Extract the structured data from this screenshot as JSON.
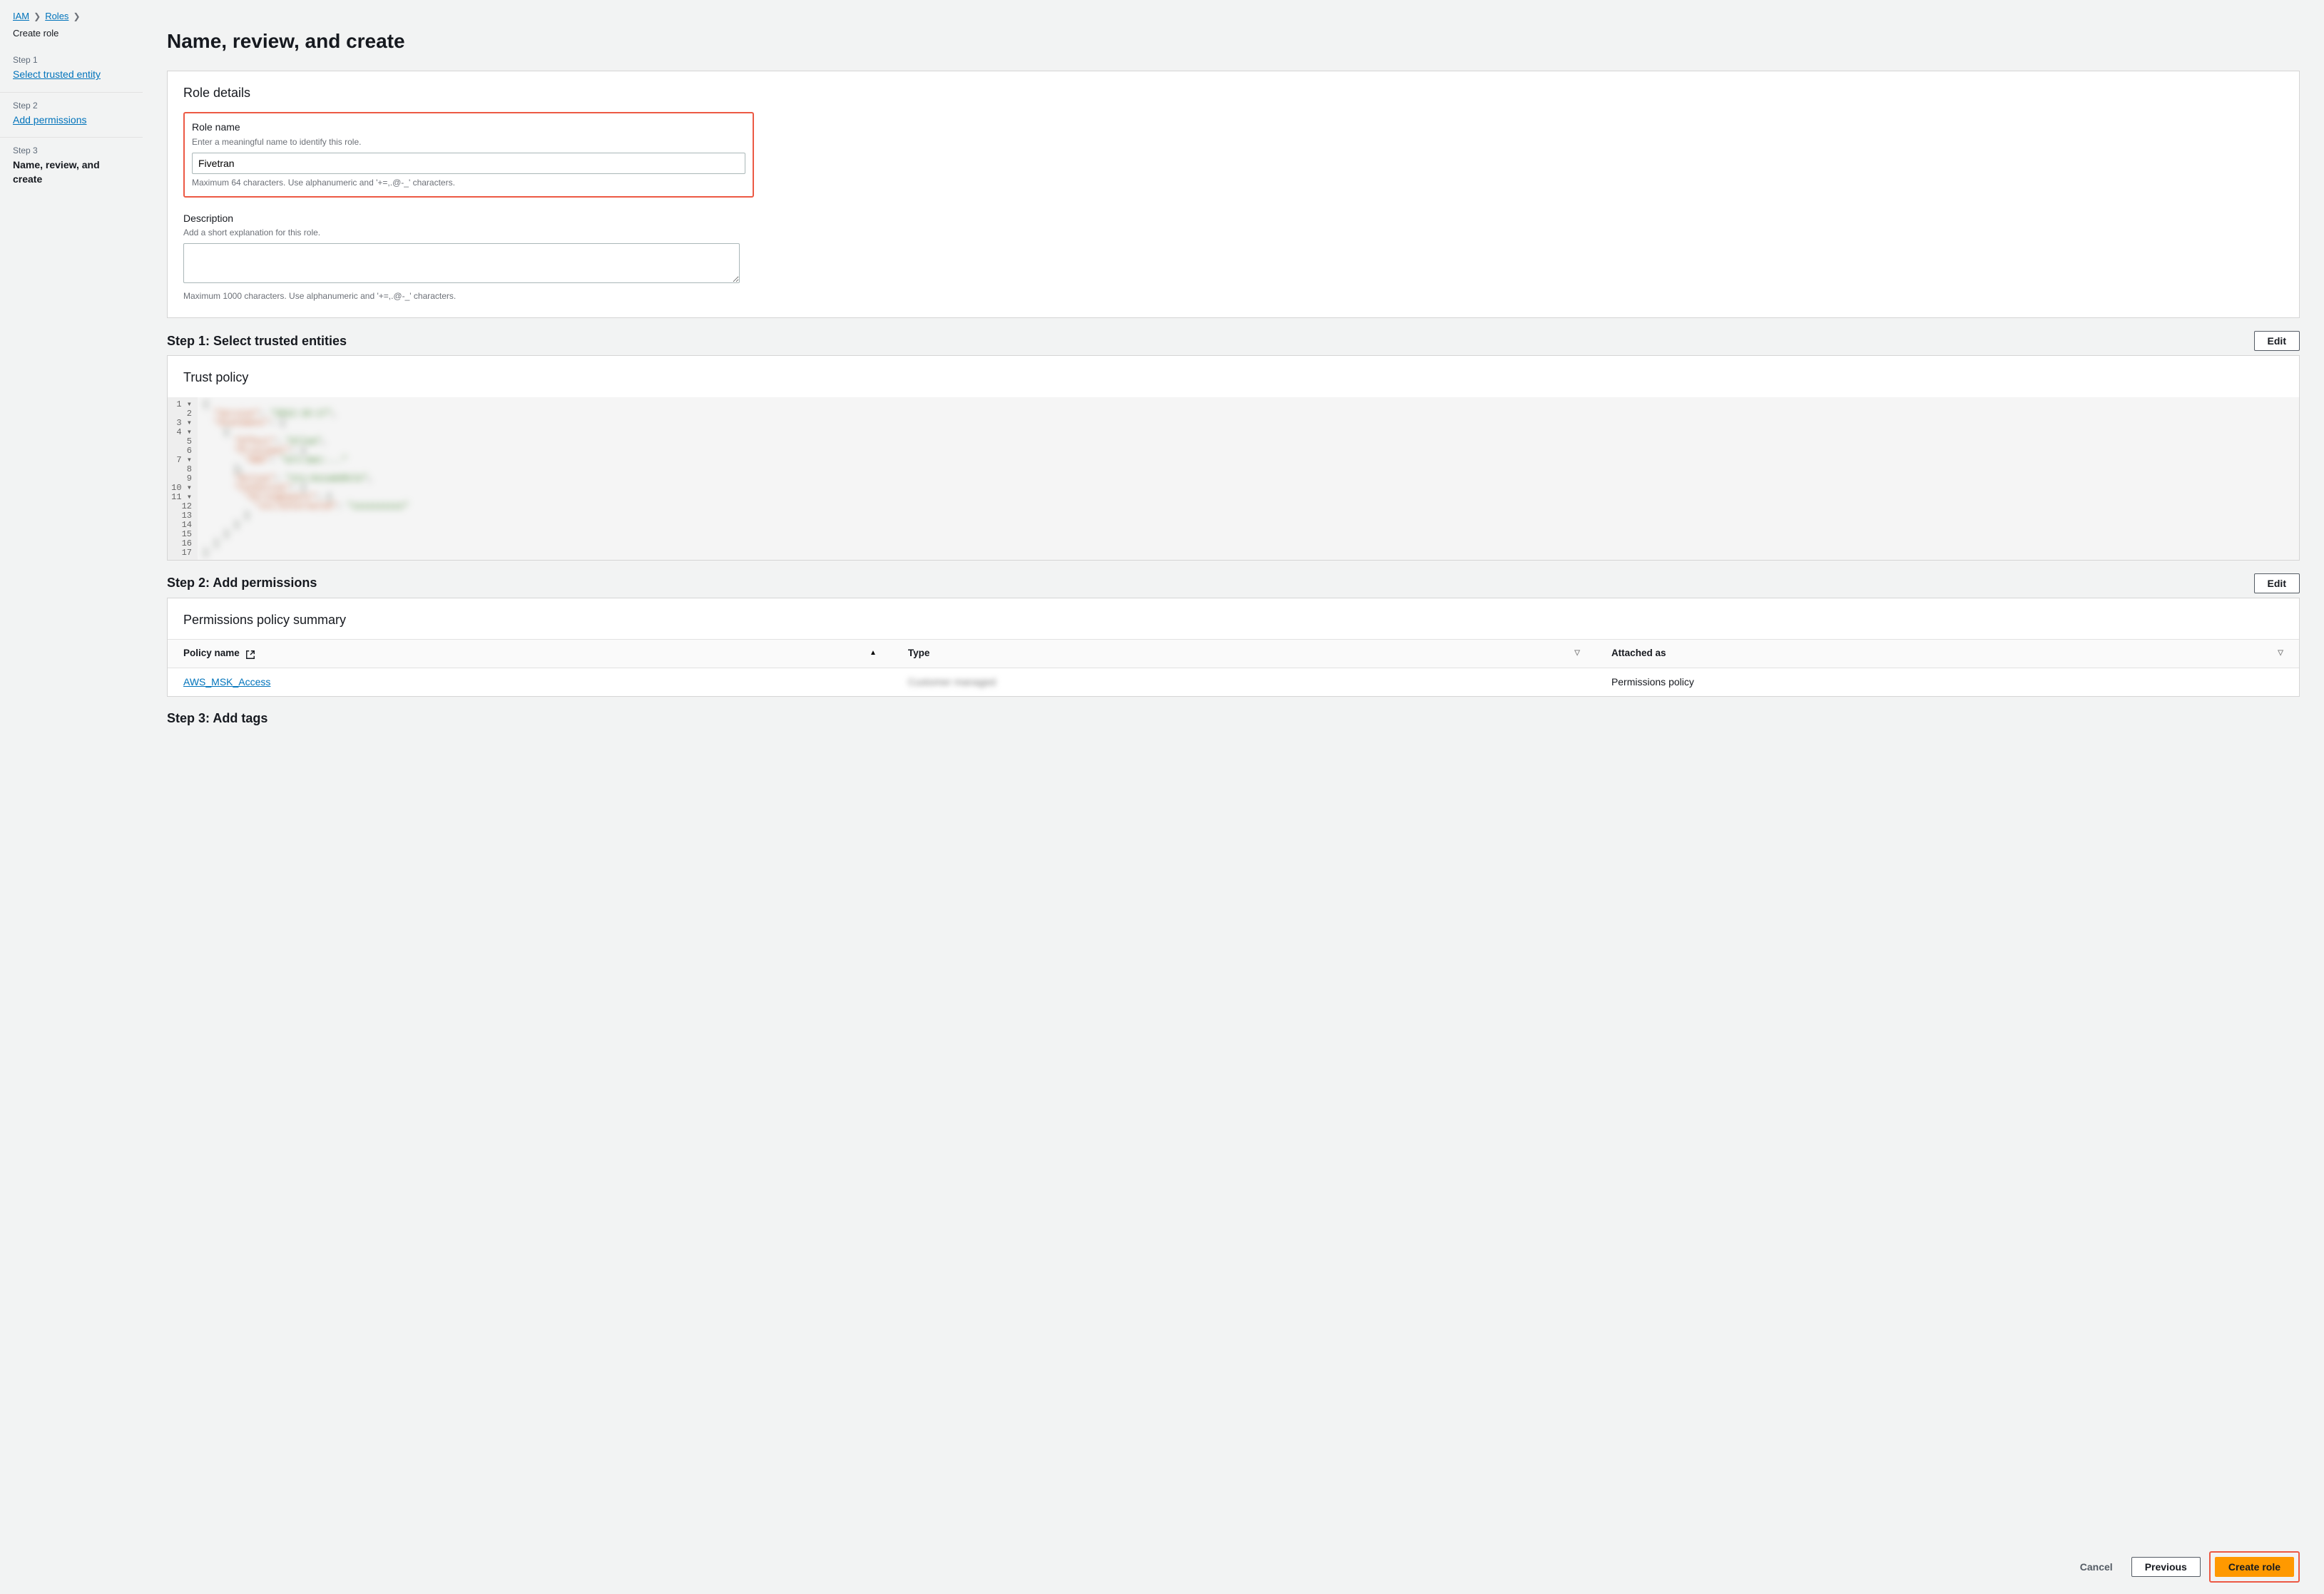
{
  "breadcrumb": {
    "iam": "IAM",
    "roles": "Roles",
    "current": "Create role"
  },
  "steps": {
    "s1_num": "Step 1",
    "s1_label": "Select trusted entity",
    "s2_num": "Step 2",
    "s2_label": "Add permissions",
    "s3_num": "Step 3",
    "s3_label": "Name, review, and create"
  },
  "page_title": "Name, review, and create",
  "role_details": {
    "panel_title": "Role details",
    "name_label": "Role name",
    "name_help": "Enter a meaningful name to identify this role.",
    "name_value": "Fivetran",
    "name_constraint": "Maximum 64 characters. Use alphanumeric and '+=,.@-_' characters.",
    "desc_label": "Description",
    "desc_help": "Add a short explanation for this role.",
    "desc_value": "",
    "desc_constraint": "Maximum 1000 characters. Use alphanumeric and '+=,.@-_' characters."
  },
  "step1_section": {
    "heading": "Step 1: Select trusted entities",
    "edit": "Edit",
    "panel_title": "Trust policy",
    "lines": [
      "1 ▾",
      "2",
      "3 ▾",
      "4 ▾",
      "5",
      "6",
      "7 ▾",
      "8",
      "9",
      "10 ▾",
      "11 ▾",
      "12",
      "13",
      "14",
      "15",
      "16",
      "17"
    ]
  },
  "step2_section": {
    "heading": "Step 2: Add permissions",
    "edit": "Edit",
    "panel_title": "Permissions policy summary",
    "col_policy": "Policy name",
    "col_type": "Type",
    "col_attached": "Attached as",
    "row": {
      "policy": "AWS_MSK_Access",
      "type": "Customer managed",
      "attached": "Permissions policy"
    }
  },
  "step3_section": {
    "heading": "Step 3: Add tags"
  },
  "footer": {
    "cancel": "Cancel",
    "previous": "Previous",
    "create": "Create role"
  }
}
